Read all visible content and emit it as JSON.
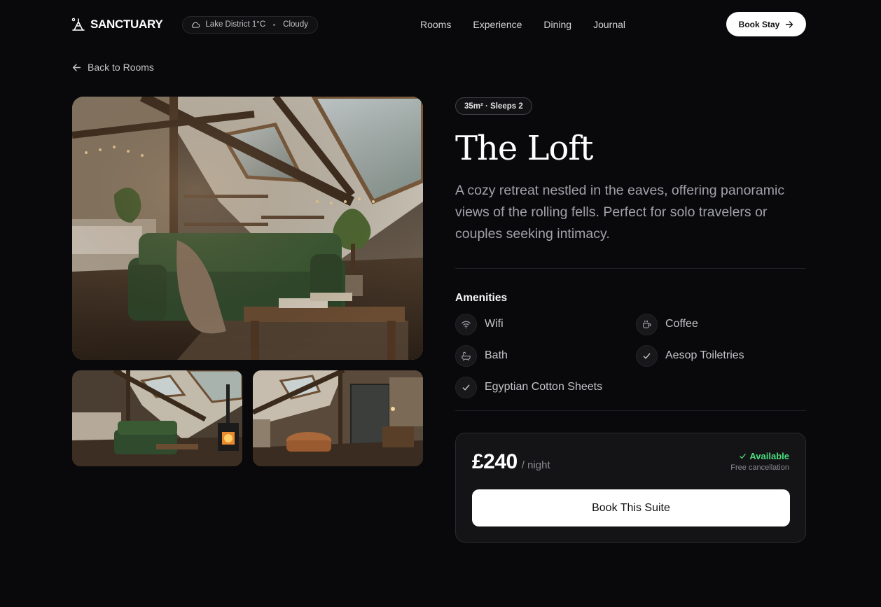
{
  "brand": {
    "name": "SANCTUARY",
    "icon": "tent-icon"
  },
  "weather": {
    "location_temp": "Lake District 1°C",
    "condition": "Cloudy",
    "icon": "cloud-icon"
  },
  "nav": {
    "items": [
      "Rooms",
      "Experience",
      "Dining",
      "Journal"
    ]
  },
  "header": {
    "cta_label": "Book Stay",
    "cta_icon": "arrow-right-icon"
  },
  "back_link": {
    "label": "Back to Rooms",
    "icon": "arrow-left-icon"
  },
  "room": {
    "badge": "35m² · Sleeps 2",
    "title": "The Loft",
    "description": "A cozy retreat nestled in the eaves, offering panoramic views of the rolling fells. Perfect for solo travelers or couples seeking intimacy."
  },
  "amenities": {
    "title": "Amenities",
    "items": [
      {
        "label": "Wifi",
        "icon": "wifi-icon"
      },
      {
        "label": "Coffee",
        "icon": "coffee-icon"
      },
      {
        "label": "Bath",
        "icon": "bath-icon"
      },
      {
        "label": "Aesop Toiletries",
        "icon": "check-icon"
      },
      {
        "label": "Egyptian Cotton Sheets",
        "icon": "check-icon"
      }
    ]
  },
  "pricing": {
    "amount": "£240",
    "unit": "/ night",
    "status": "Available",
    "status_color": "#4ade80",
    "cancellation": "Free cancellation",
    "cta_label": "Book This Suite"
  },
  "colors": {
    "background": "#09090b",
    "card": "#141416",
    "accent_button": "#ffffff"
  }
}
